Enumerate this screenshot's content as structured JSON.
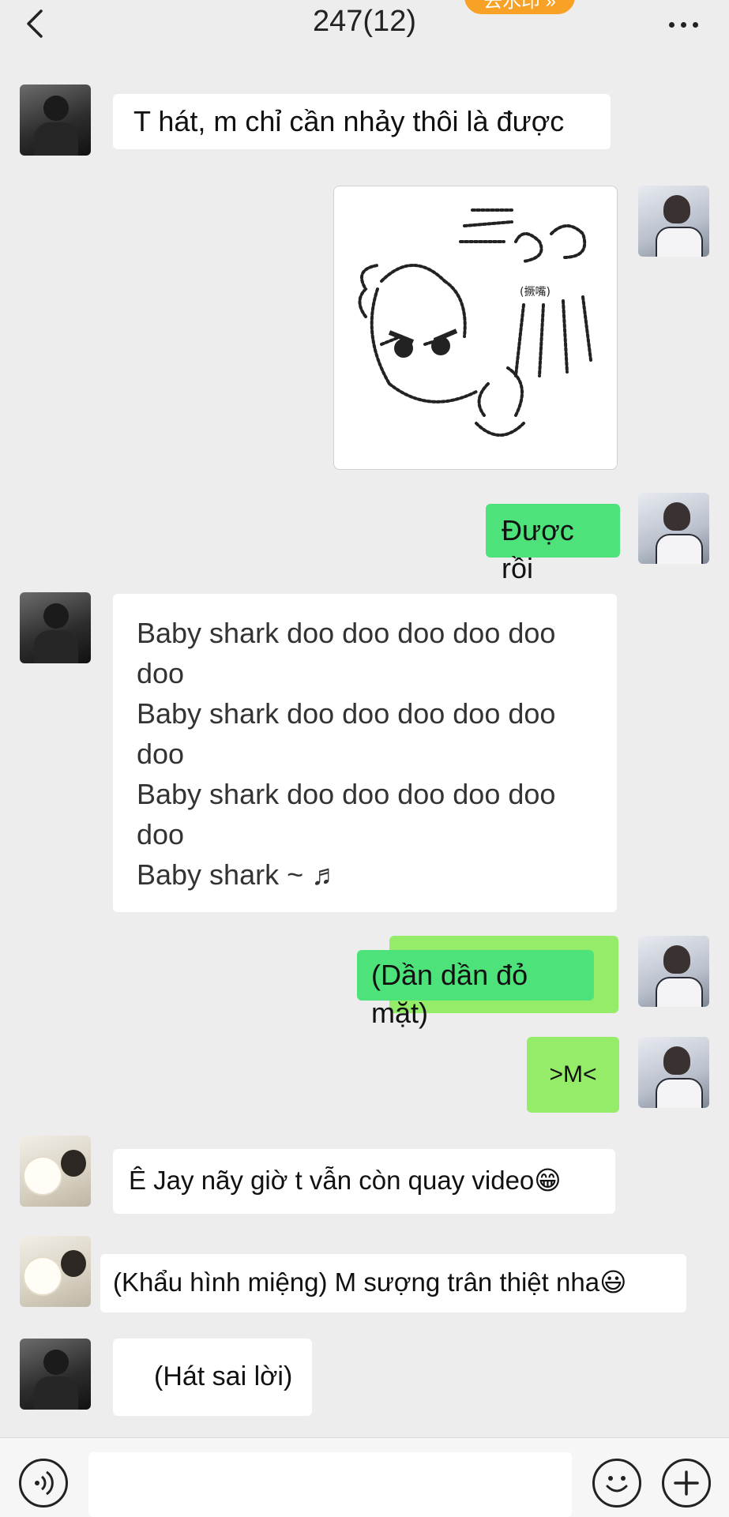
{
  "header": {
    "title": "247(12)",
    "promo_label": "去水印 »"
  },
  "messages": [
    {
      "side": "left",
      "avatar": "avatar-boy-dark",
      "text": "T hát, m chỉ cần nhảy thôi là được"
    },
    {
      "side": "right",
      "avatar": "avatar-boy-light",
      "type": "image",
      "content": "cartoon-cat-sticker",
      "sticker_caption": "(撅嘴)"
    },
    {
      "side": "right",
      "avatar": "avatar-boy-light",
      "text": "Được rồi"
    },
    {
      "side": "left",
      "avatar": "avatar-boy-dark",
      "lines": [
        "Baby shark doo doo doo doo doo",
        "doo",
        "Baby shark doo doo doo doo doo",
        "doo",
        "Baby shark doo doo doo doo doo",
        "doo",
        "Baby shark ~ ♬"
      ]
    },
    {
      "side": "right",
      "avatar": "avatar-boy-light",
      "text": "(Dần dần đỏ mặt)"
    },
    {
      "side": "right",
      "avatar": "avatar-boy-light",
      "text": ">M<"
    },
    {
      "side": "left",
      "avatar": "avatar-dog-boy",
      "text": "Ê Jay nãy giờ t vẫn còn quay video",
      "emoji": "😁"
    },
    {
      "side": "left",
      "avatar": "avatar-dog-boy",
      "text": "(Khẩu hình miệng) M sượng trân thiệt nha",
      "emoji": "😃"
    },
    {
      "side": "left",
      "avatar": "avatar-boy-dark",
      "text": "(Hát sai lời)"
    }
  ],
  "icons": {
    "back": "chevron-left-icon",
    "more": "more-dots-icon",
    "voice": "voice-icon",
    "emoji": "emoji-icon",
    "plus": "plus-icon"
  },
  "colors": {
    "background": "#ededed",
    "bubble_left": "#ffffff",
    "bubble_right": "#95ec69",
    "bubble_right_bright": "#4ee27b",
    "promo": "#f7a126"
  }
}
